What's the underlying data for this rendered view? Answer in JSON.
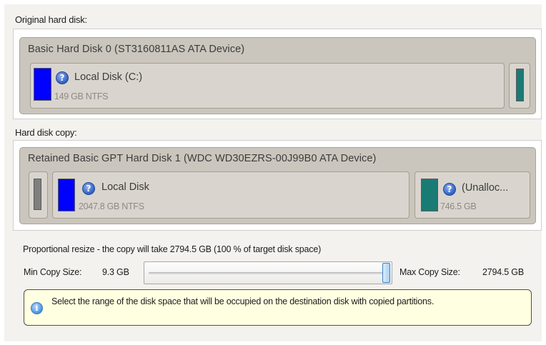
{
  "original": {
    "section_label": "Original hard disk:",
    "disk_title": "Basic Hard Disk 0 (ST3160811AS ATA Device)",
    "partition": {
      "name": "Local Disk (C:)",
      "size": "149 GB NTFS",
      "color": "#0000ff"
    },
    "trailing_partition_color": "#1a7a74"
  },
  "copy": {
    "section_label": "Hard disk copy:",
    "disk_title": "Retained Basic GPT Hard Disk 1 (WDC WD30EZRS-00J99B0 ATA Device)",
    "leading_partition_color": "#7f7f7f",
    "partition_main": {
      "name": "Local Disk",
      "size": "2047.8 GB NTFS",
      "color": "#0000ff"
    },
    "partition_unalloc": {
      "name": "(Unalloc...",
      "size": "746.5 GB",
      "color": "#1a7a74"
    }
  },
  "resize": {
    "label": "Proportional resize - the copy will take 2794.5 GB (100 % of target disk space)",
    "min_label": "Min Copy Size:",
    "min_value": "9.3 GB",
    "max_label": "Max Copy Size:",
    "max_value": "2794.5 GB",
    "slider_fraction": 1.0
  },
  "info": {
    "text": "Select the range of the disk space that will be occupied on the destination disk with copied partitions.",
    "icon": "info-icon"
  },
  "icons": {
    "help": "?",
    "info": "i"
  }
}
